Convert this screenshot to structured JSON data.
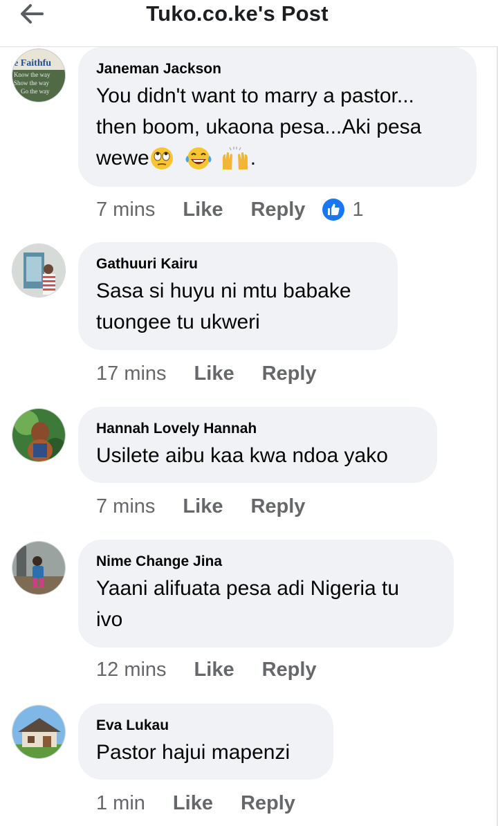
{
  "header": {
    "title": "Tuko.co.ke's Post",
    "back_icon": "arrow-left-icon"
  },
  "colors": {
    "bubble": "#f0f2f5",
    "meta": "#65676b",
    "like_blue": "#1877f2"
  },
  "comments": [
    {
      "author": "Janeman Jackson",
      "lines": [
        "You didn't want to marry a pastor...",
        "then boom, ukaona pesa...Aki pesa",
        "wewe"
      ],
      "trailing": ".",
      "emojis": [
        "face-with-rolling-eyes-emoji",
        "tears-of-joy-emoji",
        "raising-hands-emoji"
      ],
      "avatar_text": [
        "e Faithfu",
        "Know the way",
        "Show the way",
        "Go the way"
      ],
      "time": "7 mins",
      "like": "Like",
      "reply": "Reply",
      "reaction_count": "1"
    },
    {
      "author": "Gathuuri Kairu",
      "lines": [
        "Sasa si huyu ni mtu babake",
        "tuongee tu ukweri"
      ],
      "time": "17 mins",
      "like": "Like",
      "reply": "Reply"
    },
    {
      "author": "Hannah Lovely Hannah",
      "lines": [
        "Usilete aibu kaa kwa ndoa yako"
      ],
      "time": "7 mins",
      "like": "Like",
      "reply": "Reply"
    },
    {
      "author": "Nime Change Jina",
      "lines": [
        "Yaani alifuata pesa adi Nigeria tu",
        "ivo"
      ],
      "time": "12 mins",
      "like": "Like",
      "reply": "Reply"
    },
    {
      "author": "Eva Lukau",
      "lines": [
        "Pastor hajui mapenzi"
      ],
      "time": "1 min",
      "like": "Like",
      "reply": "Reply"
    }
  ]
}
